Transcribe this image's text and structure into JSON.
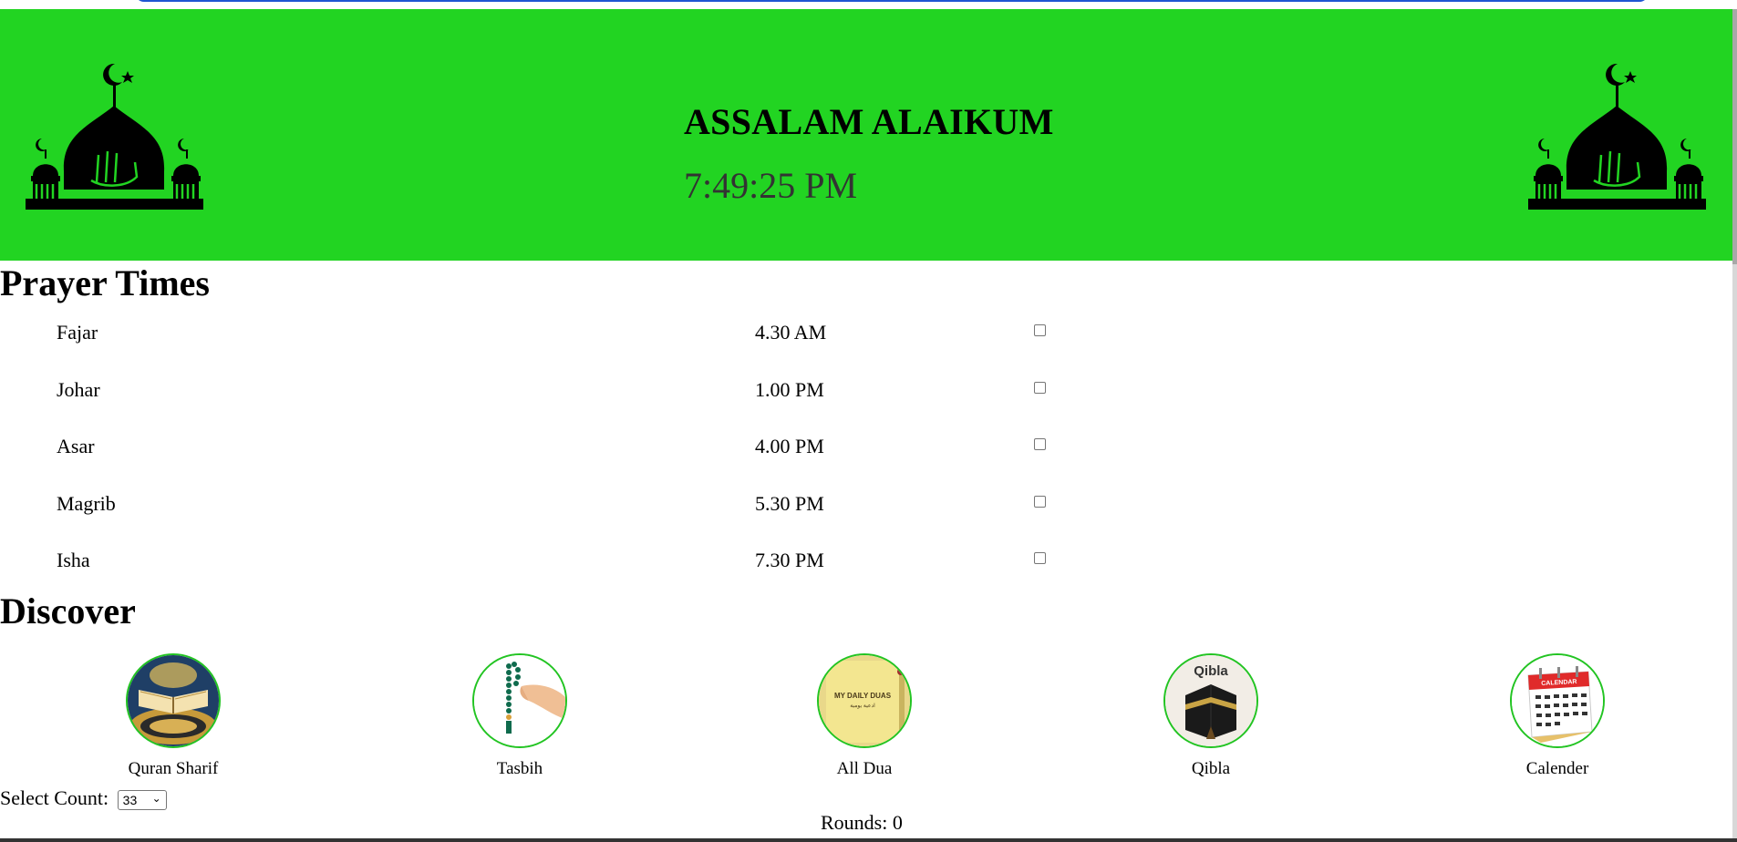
{
  "header": {
    "greeting": "ASSALAM ALAIKUM",
    "clock": "7:49:25 PM",
    "background_color": "#22d422"
  },
  "prayer_times": {
    "title": "Prayer Times",
    "rows": [
      {
        "name": "Fajar",
        "time": "4.30 AM",
        "checked": false
      },
      {
        "name": "Johar",
        "time": "1.00 PM",
        "checked": false
      },
      {
        "name": "Asar",
        "time": "4.00 PM",
        "checked": false
      },
      {
        "name": "Magrib",
        "time": "5.30 PM",
        "checked": false
      },
      {
        "name": "Isha",
        "time": "7.30 PM",
        "checked": false
      }
    ]
  },
  "discover": {
    "title": "Discover",
    "items": [
      {
        "label": "Quran Sharif",
        "icon": "quran-icon"
      },
      {
        "label": "Tasbih",
        "icon": "tasbih-icon"
      },
      {
        "label": "All Dua",
        "icon": "dua-book-icon"
      },
      {
        "label": "Qibla",
        "icon": "kaaba-icon",
        "image_text": "Qibla"
      },
      {
        "label": "Calender",
        "icon": "calendar-icon",
        "image_text": "CALENDAR"
      }
    ]
  },
  "counter": {
    "select_label": "Select Count:",
    "selected_value": "33",
    "rounds_text": "Rounds: 0"
  }
}
